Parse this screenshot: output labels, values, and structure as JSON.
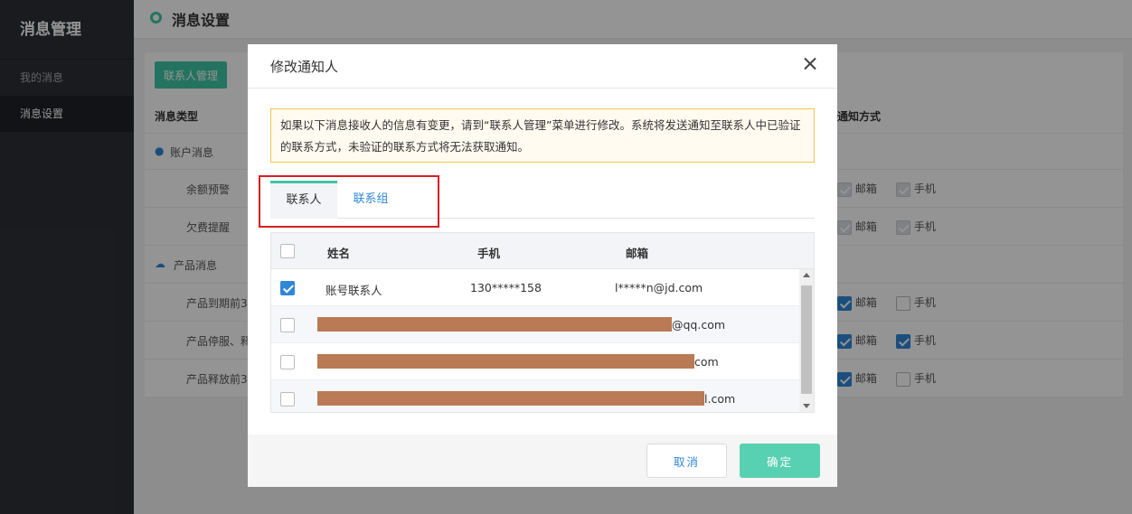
{
  "sidebar": {
    "brand": "消息管理",
    "items": [
      {
        "label": "我的消息"
      },
      {
        "label": "消息设置"
      }
    ]
  },
  "page": {
    "title": "消息设置",
    "contact_mgmt_button": "联系人管理",
    "col_type": "消息类型",
    "col_method": "通知方式",
    "groups": [
      {
        "label": "账户消息",
        "icon": "user-icon"
      },
      {
        "label": "产品消息",
        "icon": "cloud-icon"
      }
    ],
    "rows": [
      {
        "label": "余额预警",
        "email": "邮箱",
        "phone": "手机",
        "email_state": "disabled",
        "phone_state": "disabled"
      },
      {
        "label": "欠费提醒",
        "email": "邮箱",
        "phone": "手机",
        "email_state": "disabled",
        "phone_state": "disabled"
      },
      {
        "label": "产品到期前3",
        "email": "邮箱",
        "phone": "手机",
        "email_state": "checked",
        "phone_state": "unchecked"
      },
      {
        "label": "产品停服、释",
        "email": "邮箱",
        "phone": "手机",
        "email_state": "checked",
        "phone_state": "checked"
      },
      {
        "label": "产品释放前3",
        "email": "邮箱",
        "phone": "手机",
        "email_state": "checked",
        "phone_state": "unchecked"
      }
    ]
  },
  "modal": {
    "title": "修改通知人",
    "notice": "如果以下消息接收人的信息有变更，请到“联系人管理”菜单进行修改。系统将发送通知至联系人中已验证的联系方式，未验证的联系方式将无法获取通知。",
    "tabs": [
      {
        "label": "联系人",
        "active": true
      },
      {
        "label": "联系组",
        "active": false
      }
    ],
    "table": {
      "headers": {
        "name": "姓名",
        "phone": "手机",
        "email": "邮箱"
      },
      "rows": [
        {
          "checked": true,
          "name": "账号联系人",
          "phone": "130*****158",
          "email": "l*****n@jd.com"
        },
        {
          "checked": false,
          "name": "",
          "phone": "",
          "email": "@qq.com"
        },
        {
          "checked": false,
          "name": "",
          "phone": "",
          "email": "com"
        },
        {
          "checked": false,
          "name": "",
          "phone": "",
          "email": "l.com"
        }
      ]
    },
    "cancel_label": "取消",
    "ok_label": "确定"
  },
  "colors": {
    "accent": "#3ec7a5",
    "link": "#2f87d8",
    "highlight": "#d71d24",
    "redaction": "#b97a55"
  }
}
